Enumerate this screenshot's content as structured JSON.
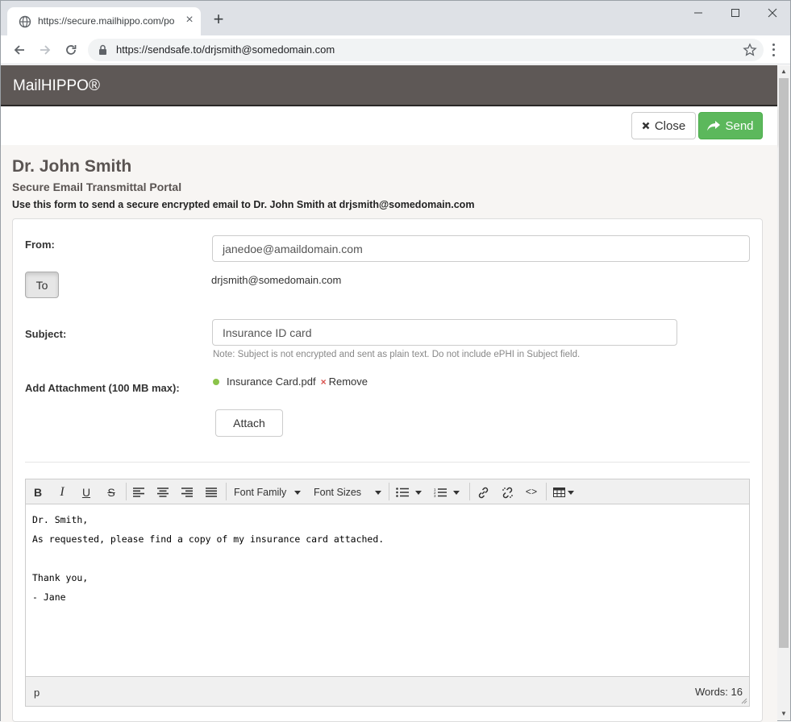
{
  "browser": {
    "tab_title": "https://secure.mailhippo.com/po",
    "url": "https://sendsafe.to/drjsmith@somedomain.com"
  },
  "app": {
    "brand": "MailHIPPO®",
    "close_label": "Close",
    "send_label": "Send"
  },
  "header": {
    "name": "Dr. John Smith",
    "subtitle": "Secure Email Transmittal Portal",
    "description": "Use this form to send a secure encrypted email to Dr. John Smith at drjsmith@somedomain.com"
  },
  "form": {
    "from_label": "From:",
    "from_value": "janedoe@amaildomain.com",
    "to_button": "To",
    "to_value": "drjsmith@somedomain.com",
    "subject_label": "Subject:",
    "subject_value": "Insurance ID card",
    "subject_note": "Note: Subject is not encrypted and sent as plain text. Do not include ePHI in Subject field.",
    "attachment_label": "Add Attachment (100 MB max):",
    "attachment_file": "Insurance Card.pdf",
    "remove_x": "×",
    "remove_label": "Remove",
    "attach_button": "Attach"
  },
  "editor": {
    "bold": "B",
    "italic": "I",
    "underline": "U",
    "strike": "S",
    "font_family": "Font Family",
    "font_sizes": "Font Sizes",
    "code": "<>",
    "body_lines": [
      "Dr. Smith,",
      "As requested, please find a copy of my insurance card attached.",
      "",
      "Thank you,",
      "- Jane"
    ],
    "status_path": "p",
    "word_count": "Words: 16"
  },
  "colors": {
    "appbar": "#5e5856",
    "send_button": "#5cb85c",
    "attachment_dot": "#8bc34a",
    "remove_x": "#d9534f"
  }
}
